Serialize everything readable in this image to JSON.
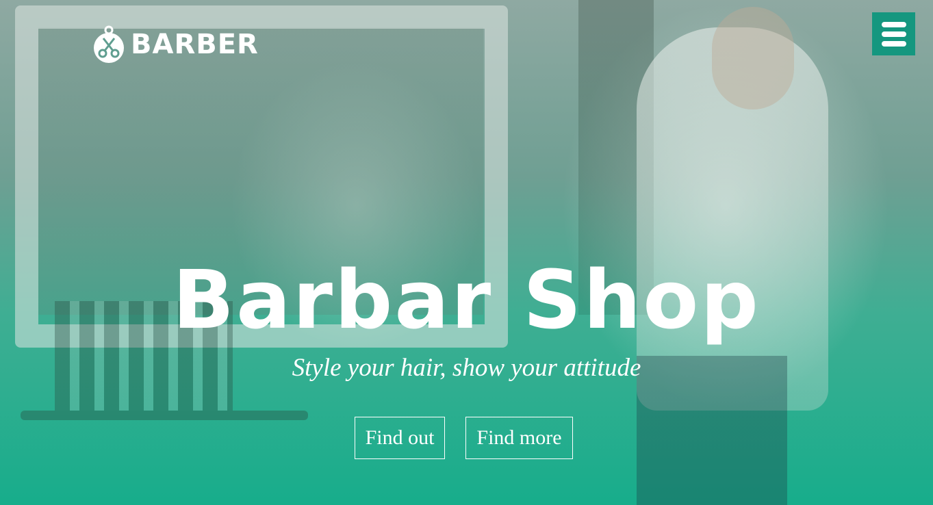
{
  "header": {
    "logo_text": "BARBER",
    "logo_icon": "barber-scissors-logo",
    "menu_icon": "hamburger-menu-icon"
  },
  "hero": {
    "title": "Barbar Shop",
    "subtitle": "Style your hair, show your attitude",
    "buttons": [
      {
        "label": "Find out"
      },
      {
        "label": "Find more"
      }
    ]
  },
  "colors": {
    "accent": "#15977f",
    "overlay_bottom": "#17ad8b",
    "text": "#ffffff"
  }
}
